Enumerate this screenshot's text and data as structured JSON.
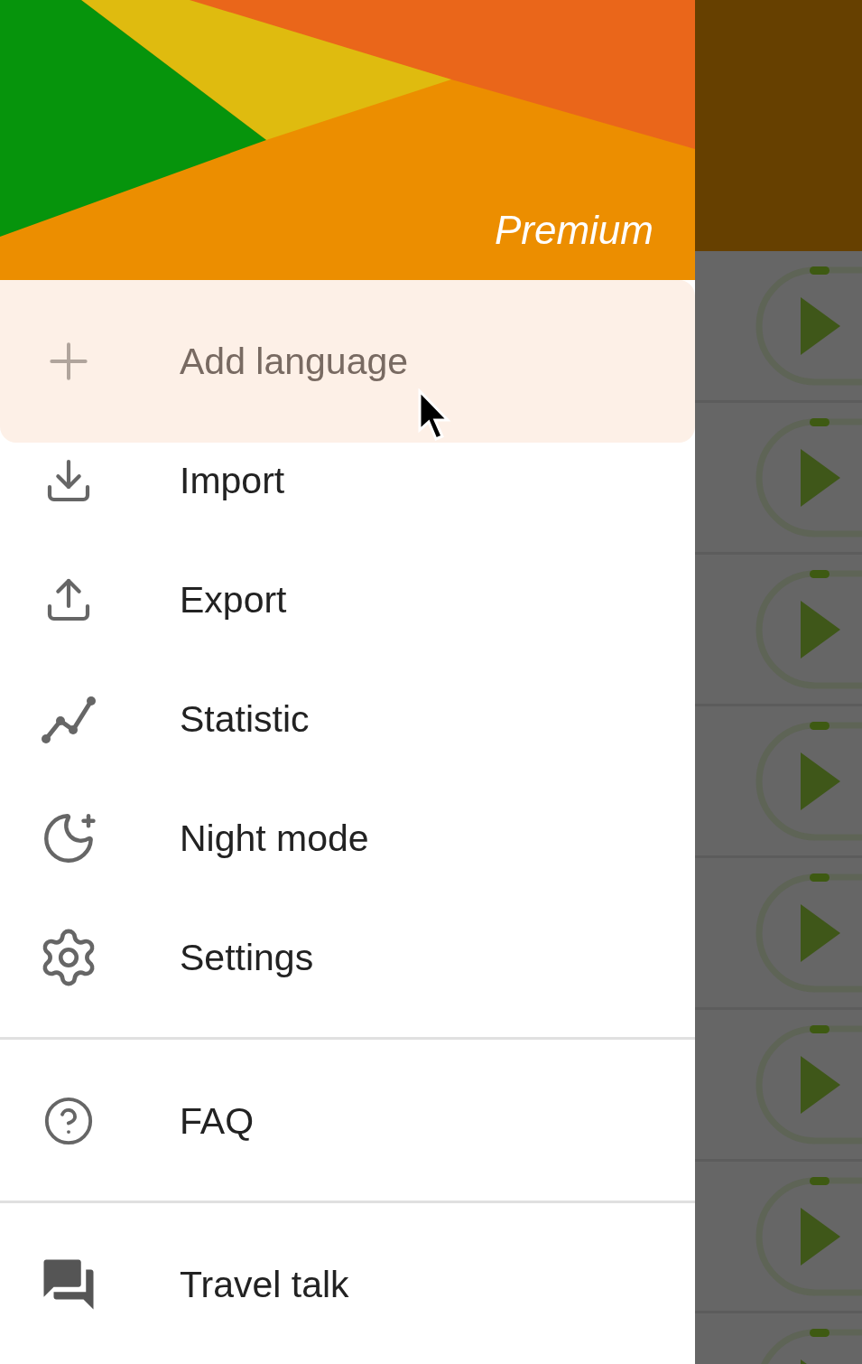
{
  "drawer": {
    "header": {
      "badge": "Premium"
    },
    "groups": [
      {
        "items": [
          {
            "label": "Add language",
            "selected": true
          },
          {
            "label": "Import",
            "selected": false
          },
          {
            "label": "Export",
            "selected": false
          },
          {
            "label": "Statistic",
            "selected": false
          },
          {
            "label": "Night mode",
            "selected": false
          },
          {
            "label": "Settings",
            "selected": false
          }
        ]
      },
      {
        "items": [
          {
            "label": "FAQ",
            "selected": false
          }
        ]
      },
      {
        "items": [
          {
            "label": "Travel talk",
            "selected": false
          }
        ]
      }
    ]
  },
  "background_list": {
    "rows": [
      {
        "kind": "play"
      },
      {
        "kind": "play"
      },
      {
        "kind": "play"
      },
      {
        "kind": "play"
      },
      {
        "kind": "play"
      },
      {
        "kind": "play"
      },
      {
        "kind": "play"
      },
      {
        "kind": "play"
      }
    ]
  }
}
